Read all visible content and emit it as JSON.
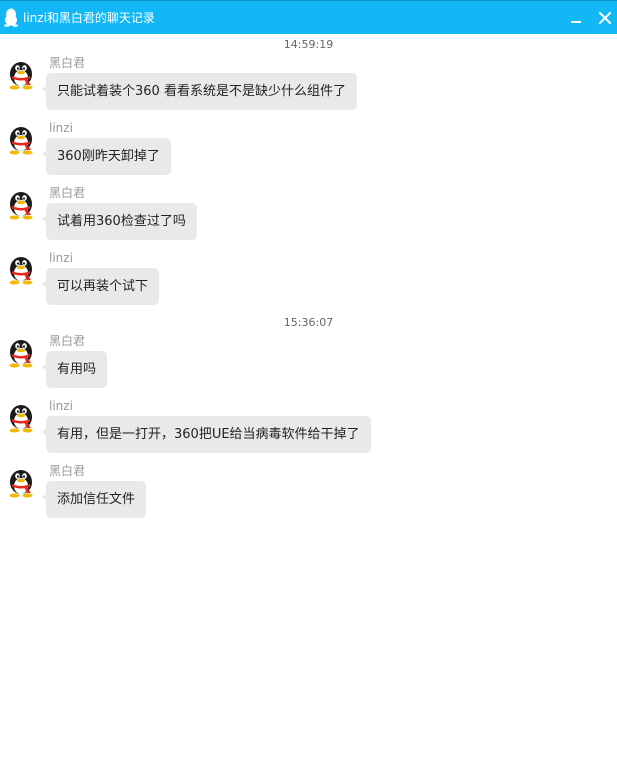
{
  "window": {
    "title": "linzi和黑白君的聊天记录",
    "icons": {
      "app": "qq-penguin-icon",
      "minimize": "minimize-icon",
      "close": "close-icon"
    }
  },
  "colors": {
    "titlebar": "#12b7f5",
    "bubble": "#e9e9e9",
    "sender": "#999999",
    "timestamp": "#666666"
  },
  "timestamps": [
    "14:59:19",
    "15:36:07"
  ],
  "messages": [
    {
      "sender": "黑白君",
      "text": "只能试着装个360  看看系统是不是缺少什么组件了"
    },
    {
      "sender": "linzi",
      "text": "360刚昨天卸掉了"
    },
    {
      "sender": "黑白君",
      "text": "试着用360检查过了吗"
    },
    {
      "sender": "linzi",
      "text": "可以再装个试下"
    },
    {
      "sender": "黑白君",
      "text": "有用吗"
    },
    {
      "sender": "linzi",
      "text": "有用，但是一打开，360把UE给当病毒软件给干掉了"
    },
    {
      "sender": "黑白君",
      "text": "添加信任文件"
    }
  ]
}
